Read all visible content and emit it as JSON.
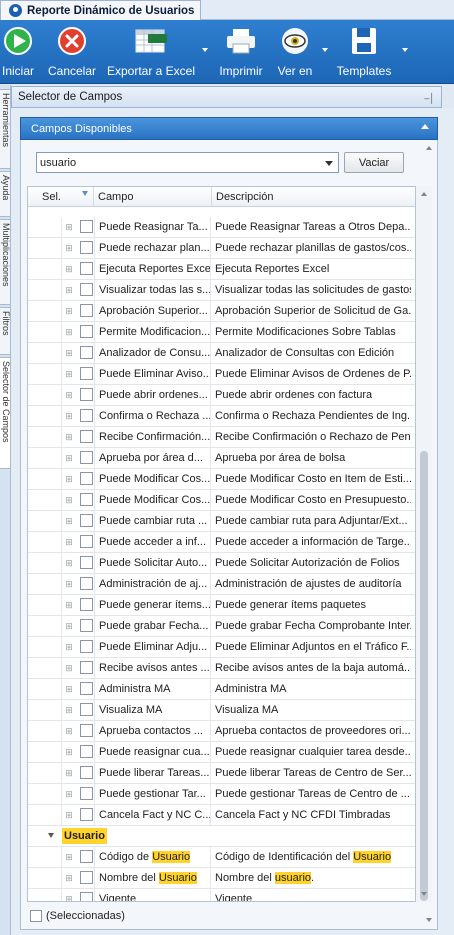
{
  "window": {
    "tab_title": "Reporte Dinámico de Usuarios"
  },
  "toolbar": {
    "iniciar": "Iniciar",
    "cancelar": "Cancelar",
    "exportar": "Exportar a Excel",
    "excel_badge": "Excel",
    "imprimir": "Imprimir",
    "ver_en": "Ver en",
    "templates": "Templates"
  },
  "left_rail": {
    "tabs": [
      "Herramientas",
      "Ayuda",
      "Multiplicaciones",
      "Filtros",
      "Selector de Campos"
    ]
  },
  "panel": {
    "title": "Selector de Campos"
  },
  "group": {
    "title": "Campos Disponibles"
  },
  "search": {
    "value": "usuario",
    "clear_label": "Vaciar"
  },
  "grid": {
    "col_sel": "Sel.",
    "col_campo": "Campo",
    "col_descripcion": "Descripción",
    "rows": [
      {
        "campo": "Puede Reasignar Ta...",
        "desc": "Puede Reasignar Tareas a Otros Depa..."
      },
      {
        "campo": "Puede rechazar plan...",
        "desc": "Puede rechazar planillas de gastos/cos..."
      },
      {
        "campo": "Ejecuta Reportes Excel",
        "desc": "Ejecuta Reportes Excel"
      },
      {
        "campo": "Visualizar todas las s...",
        "desc": "Visualizar todas las solicitudes de gastos"
      },
      {
        "campo": "Aprobación Superior...",
        "desc": "Aprobación Superior de Solicitud de Ga..."
      },
      {
        "campo": "Permite Modificacion...",
        "desc": "Permite Modificaciones Sobre Tablas"
      },
      {
        "campo": "Analizador de Consu...",
        "desc": "Analizador de Consultas con Edición"
      },
      {
        "campo": "Puede Eliminar Aviso...",
        "desc": "Puede Eliminar Avisos de Ordenes de P..."
      },
      {
        "campo": "Puede abrir ordenes...",
        "desc": "Puede abrir ordenes con factura"
      },
      {
        "campo": "Confirma o Rechaza ...",
        "desc": "Confirma o Rechaza Pendientes de Ing..."
      },
      {
        "campo": "Recibe Confirmación...",
        "desc": "Recibe Confirmación o Rechazo de Pen..."
      },
      {
        "campo": "Aprueba por área d...",
        "desc": "Aprueba por área de bolsa"
      },
      {
        "campo": "Puede Modificar Cos...",
        "desc": "Puede Modificar Costo en Item de Esti..."
      },
      {
        "campo": "Puede Modificar Cos...",
        "desc": "Puede Modificar Costo en Presupuesto..."
      },
      {
        "campo": "Puede cambiar ruta ...",
        "desc": "Puede cambiar ruta para Adjuntar/Ext..."
      },
      {
        "campo": "Puede acceder a inf...",
        "desc": "Puede acceder a información de Targe..."
      },
      {
        "campo": "Puede Solicitar Auto...",
        "desc": "Puede Solicitar Autorización de Folios"
      },
      {
        "campo": "Administración de aj...",
        "desc": "Administración de ajustes de auditoría"
      },
      {
        "campo": "Puede generar ítems...",
        "desc": "Puede generar ítems paquetes"
      },
      {
        "campo": "Puede grabar Fecha...",
        "desc": "Puede grabar Fecha Comprobante Inter..."
      },
      {
        "campo": "Puede Eliminar Adju...",
        "desc": "Puede Eliminar Adjuntos en el Tráfico F..."
      },
      {
        "campo": "Recibe avisos antes ...",
        "desc": "Recibe avisos antes de la baja automá..."
      },
      {
        "campo": "Administra MA",
        "desc": "Administra MA"
      },
      {
        "campo": "Visualiza MA",
        "desc": "Visualiza MA"
      },
      {
        "campo": "Aprueba contactos ...",
        "desc": "Aprueba contactos de proveedores ori..."
      },
      {
        "campo": "Puede reasignar cua...",
        "desc": "Puede reasignar cualquier tarea desde..."
      },
      {
        "campo": "Puede liberar Tareas...",
        "desc": "Puede liberar Tareas de Centro de Ser..."
      },
      {
        "campo": "Puede gestionar Tar...",
        "desc": "Puede gestionar Tareas de Centro de ..."
      },
      {
        "campo": "Cancela Fact y NC C...",
        "desc": "Cancela Fact y NC CFDI Timbradas"
      }
    ],
    "usuario_group": {
      "name": "Usuario",
      "rows": [
        {
          "campo_pre": "Código de ",
          "campo_hl": "Usuario",
          "campo_post": "",
          "desc_pre": "Código de Identificación del ",
          "desc_hl": "Usuario",
          "desc_post": ""
        },
        {
          "campo_pre": "Nombre del ",
          "campo_hl": "Usuario",
          "campo_post": "",
          "desc_pre": "Nombre del ",
          "desc_hl": "usuario",
          "desc_post": "."
        },
        {
          "campo_pre": "Vigente",
          "campo_hl": "",
          "campo_post": "",
          "desc_pre": "Vigente",
          "desc_hl": "",
          "desc_post": ""
        }
      ]
    }
  },
  "footer": {
    "selected_label": "(Seleccionadas)"
  },
  "colors": {
    "ribbon": "#1d66b6",
    "highlight": "#ffd32b",
    "group_header": "#2a73c4"
  }
}
